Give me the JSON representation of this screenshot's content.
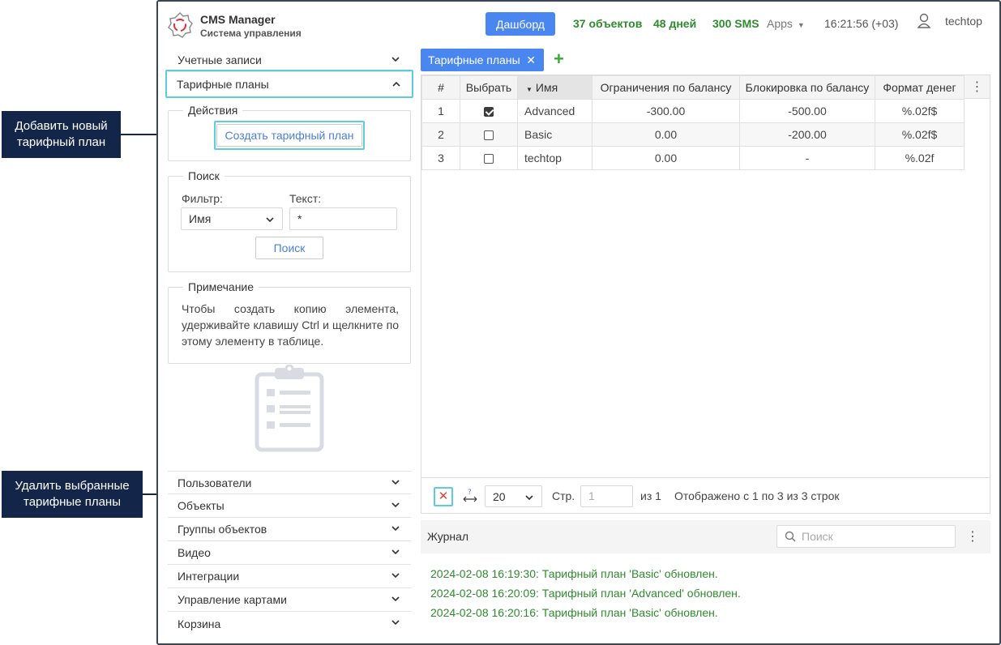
{
  "callouts": {
    "add_plan": "Добавить новый тарифный план",
    "delete_plans": "Удалить выбранные тарифные планы"
  },
  "header": {
    "app_name": "CMS Manager",
    "app_subtitle": "Система управления",
    "dashboard_label": "Дашборд",
    "objects_stat": "37 объектов",
    "days_stat": "48 дней",
    "sms_stat": "300 SMS",
    "apps_label": "Apps",
    "clock": "16:21:56 (+03)",
    "user": "techtop"
  },
  "sidebar": {
    "accounts": "Учетные записи",
    "tariff_plans": "Тарифные планы",
    "actions_legend": "Действия",
    "create_plan": "Создать тарифный план",
    "search_legend": "Поиск",
    "filter_label": "Фильтр:",
    "text_label": "Текст:",
    "filter_value": "Имя",
    "text_value": "*",
    "search_button": "Поиск",
    "note_legend": "Примечание",
    "note_text": "Чтобы создать копию элемента, удерживайте клавишу Ctrl и щелкните по этому элементу в таблице.",
    "users": "Пользователи",
    "objects": "Объекты",
    "object_groups": "Группы объектов",
    "video": "Видео",
    "integrations": "Интеграции",
    "maps": "Управление картами",
    "trash": "Корзина"
  },
  "tab": {
    "label": "Тарифные планы",
    "add": "+"
  },
  "table": {
    "columns": [
      "#",
      "Выбрать",
      "Имя",
      "Ограничения по балансу",
      "Блокировка по балансу",
      "Формат денег"
    ],
    "rows": [
      {
        "n": "1",
        "checked": true,
        "name": "Advanced",
        "limit": "-300.00",
        "block": "-500.00",
        "format": "%.02f$"
      },
      {
        "n": "2",
        "checked": false,
        "name": "Basic",
        "limit": "0.00",
        "block": "-200.00",
        "format": "%.02f$"
      },
      {
        "n": "3",
        "checked": false,
        "name": "techtop",
        "limit": "0.00",
        "block": "-",
        "format": "%.02f"
      }
    ]
  },
  "pager": {
    "page_size": "20",
    "page_label": "Стр.",
    "page_value": "1",
    "of_label": "из 1",
    "shown": "Отображено с 1 по 3 из 3 строк"
  },
  "journal": {
    "title": "Журнал",
    "search_placeholder": "Поиск",
    "lines": [
      "2024-02-08 16:19:30: Тарифный план 'Basic' обновлен.",
      "2024-02-08 16:20:09: Тарифный план 'Advanced' обновлен.",
      "2024-02-08 16:20:16: Тарифный план 'Basic' обновлен."
    ]
  },
  "colors": {
    "accent": "#4a86f0",
    "stat_green": "#2e8b2e",
    "highlight": "#5ccde0",
    "callout_bg": "#14254a"
  }
}
